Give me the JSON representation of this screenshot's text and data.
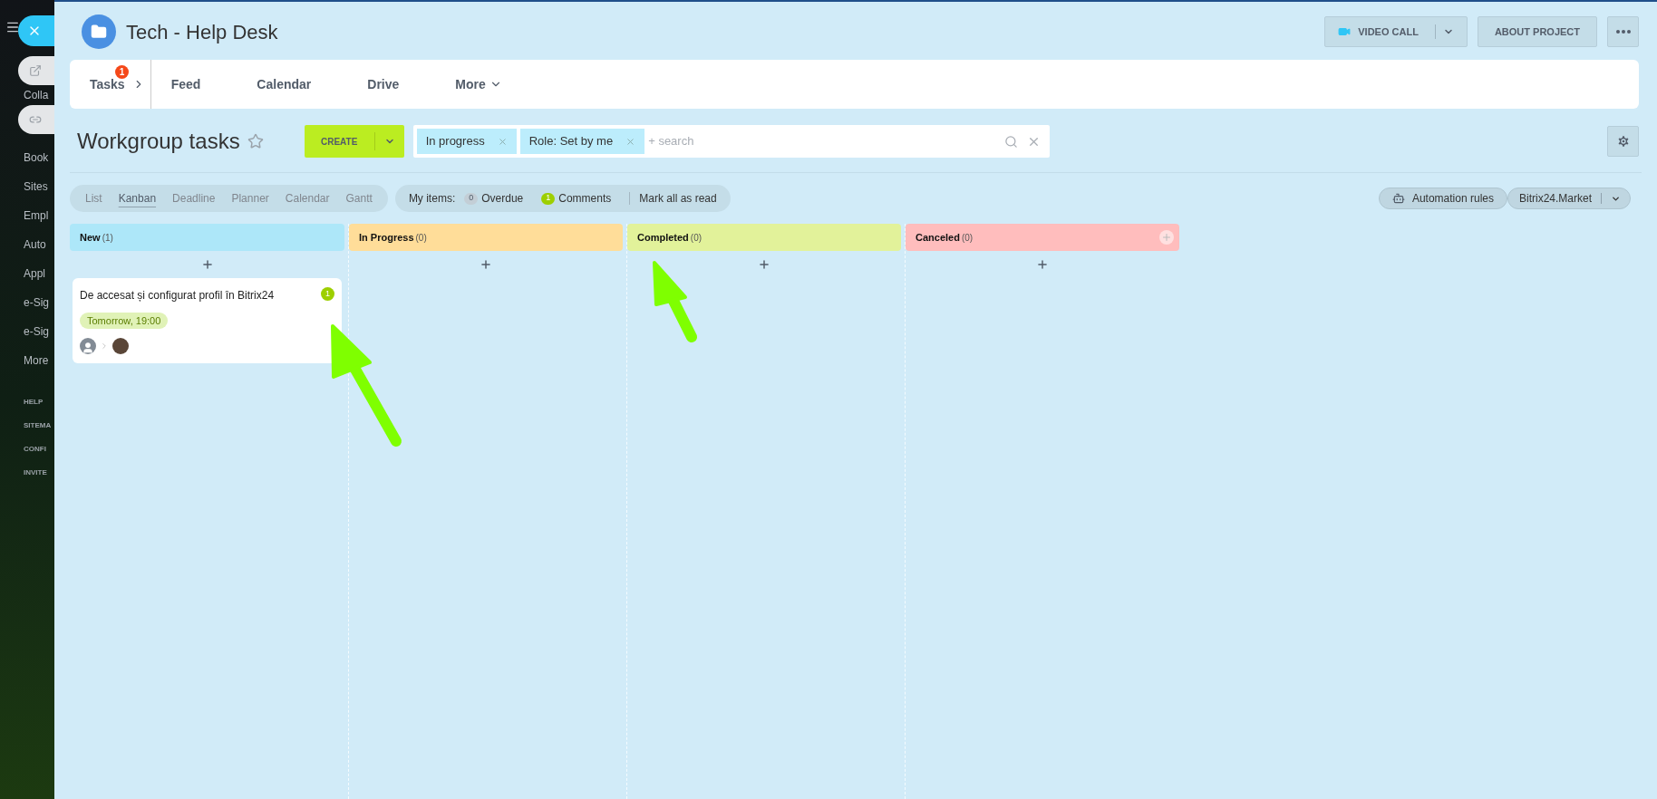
{
  "sidebar": {
    "items": [
      "Colla",
      "Book",
      "Sites",
      "Empl",
      "Auto",
      "Appl",
      "e-Sig",
      "e-Sig",
      "More"
    ],
    "footer_items": [
      "HELP",
      "SITEMA",
      "CONFI",
      "INVITE"
    ]
  },
  "header": {
    "title": "Tech - Help Desk",
    "video_call": "VIDEO CALL",
    "about": "ABOUT PROJECT"
  },
  "nav": [
    {
      "label": "Tasks",
      "badge": "1"
    },
    {
      "label": "Feed"
    },
    {
      "label": "Calendar"
    },
    {
      "label": "Drive"
    },
    {
      "label": "More",
      "dropdown": true
    }
  ],
  "page_title": "Workgroup tasks",
  "create": "CREATE",
  "filters": [
    "In progress",
    "Role: Set by me"
  ],
  "search": {
    "placeholder": "+ search"
  },
  "views": [
    {
      "label": "List",
      "selected": false
    },
    {
      "label": "Kanban",
      "selected": true
    },
    {
      "label": "Deadline",
      "selected": false
    },
    {
      "label": "Planner",
      "selected": false
    },
    {
      "label": "Calendar",
      "selected": false
    },
    {
      "label": "Gantt",
      "selected": false
    }
  ],
  "my_items": {
    "label": "My items:",
    "counters": [
      {
        "count": "0",
        "label": "Overdue",
        "color": "#c3ced6"
      },
      {
        "count": "1",
        "label": "Comments",
        "color": "#9dcf00"
      }
    ],
    "mark_all": "Mark all as read"
  },
  "automation": "Automation rules",
  "market": "Bitrix24.Market",
  "columns": [
    {
      "title": "New",
      "count": "(1)",
      "color": "#ade7f9",
      "cards": [
        {
          "title": "De accesat și configurat profil în Bitrix24",
          "comments": "1",
          "deadline": "Tomorrow, 19:00"
        }
      ]
    },
    {
      "title": "In Progress",
      "count": "(0)",
      "color": "#ffdd99"
    },
    {
      "title": "Completed",
      "count": "(0)",
      "color": "#e2f29a"
    },
    {
      "title": "Canceled",
      "count": "(0)",
      "color": "#ffbdbd"
    }
  ]
}
